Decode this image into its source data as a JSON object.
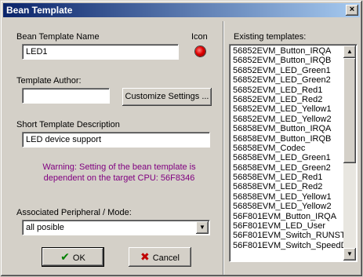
{
  "window": {
    "title": "Bean Template",
    "close_glyph": "×"
  },
  "form": {
    "name_label": "Bean Template Name",
    "icon_label": "Icon",
    "name_value": "LED1",
    "author_label": "Template Author:",
    "author_value": "",
    "customize_label": "Customize Settings ...",
    "description_label": "Short Template Description",
    "description_value": "LED device support",
    "warning_text": "Warning: Setting of the bean template is dependent on the target CPU: 56F8346",
    "peripheral_label": "Associated Peripheral / Mode:",
    "peripheral_value": "all posible",
    "ok_label": "OK",
    "cancel_label": "Cancel"
  },
  "templates": {
    "label": "Existing templates:",
    "items": [
      "56852EVM_Button_IRQA",
      "56852EVM_Button_IRQB",
      "56852EVM_LED_Green1",
      "56852EVM_LED_Green2",
      "56852EVM_LED_Red1",
      "56852EVM_LED_Red2",
      "56852EVM_LED_Yellow1",
      "56852EVM_LED_Yellow2",
      "56858EVM_Button_IRQA",
      "56858EVM_Button_IRQB",
      "56858EVM_Codec",
      "56858EVM_LED_Green1",
      "56858EVM_LED_Green2",
      "56858EVM_LED_Red1",
      "56858EVM_LED_Red2",
      "56858EVM_LED_Yellow1",
      "56858EVM_LED_Yellow2",
      "56F801EVM_Button_IRQA",
      "56F801EVM_LED_User",
      "56F801EVM_Switch_RUNST",
      "56F801EVM_Switch_SpeedD"
    ]
  },
  "colors": {
    "warning": "#800080",
    "titlebar": "#0a246a"
  }
}
